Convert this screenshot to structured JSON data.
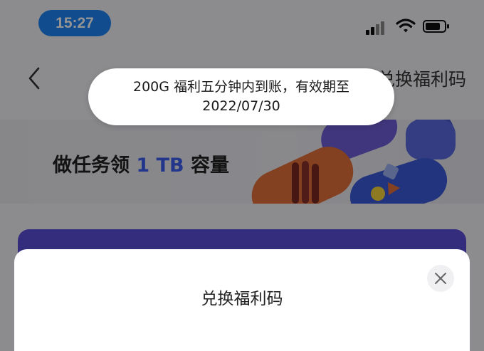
{
  "status_bar": {
    "time": "15:27"
  },
  "nav": {
    "title": "兑换福利码"
  },
  "banner": {
    "text_prefix": "做任务领 ",
    "highlight": "1 TB",
    "text_suffix": " 容量"
  },
  "toast": {
    "line1": "200G 福利五分钟内到账，有效期至",
    "line2": "2022/07/30"
  },
  "sheet": {
    "title": "兑换福利码"
  },
  "colors": {
    "accent": "#1e84f5",
    "highlight": "#3b5ef0",
    "card": "#5b4fd9"
  }
}
